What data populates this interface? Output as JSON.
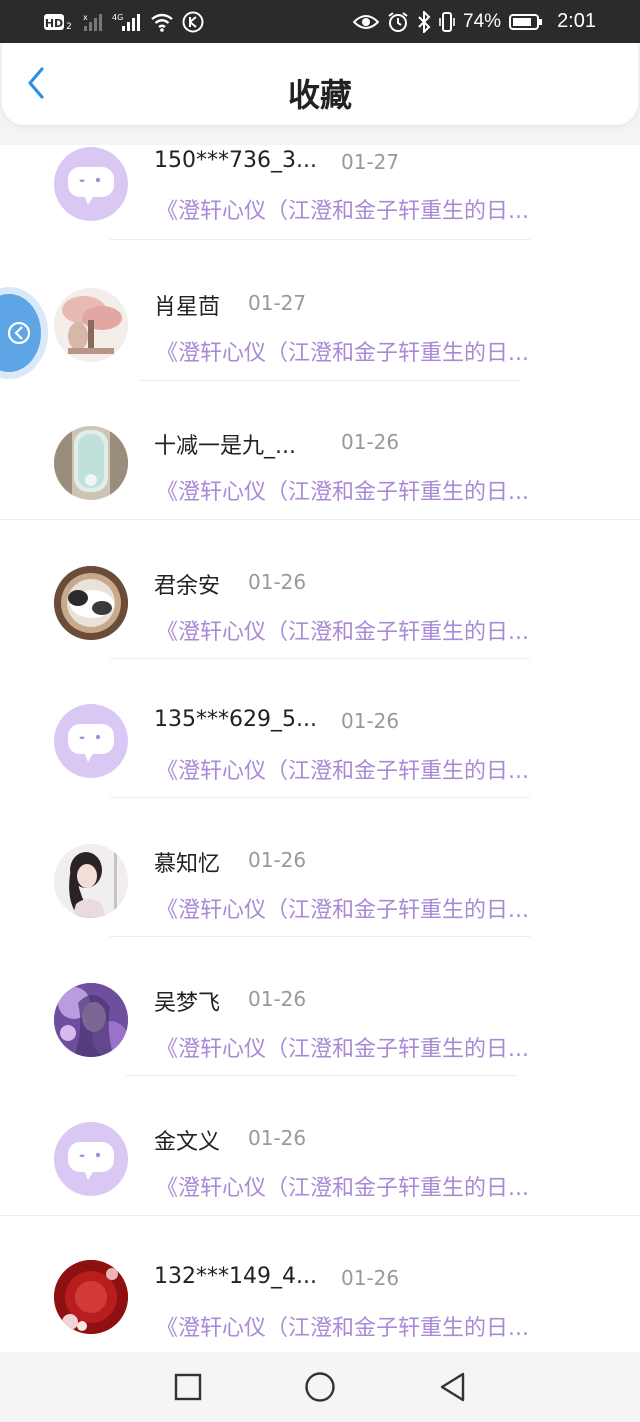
{
  "status_bar": {
    "hd_label": "HD",
    "network_label": "4G",
    "battery_percent": "74%",
    "time": "2:01"
  },
  "header": {
    "title": "收藏",
    "back_icon": "chevron-left-icon"
  },
  "items": [
    {
      "name": "150***736_3...",
      "date": "01-27",
      "title": "《澄轩心仪（江澄和金子轩重生的日...",
      "avatar": "default"
    },
    {
      "name": "肖星茴",
      "date": "01-27",
      "title": "《澄轩心仪（江澄和金子轩重生的日...",
      "avatar": "photo-pink"
    },
    {
      "name": "十减一是九_...",
      "date": "01-26",
      "title": "《澄轩心仪（江澄和金子轩重生的日...",
      "avatar": "photo-window"
    },
    {
      "name": "君余安",
      "date": "01-26",
      "title": "《澄轩心仪（江澄和金子轩重生的日...",
      "avatar": "photo-cat"
    },
    {
      "name": "135***629_5...",
      "date": "01-26",
      "title": "《澄轩心仪（江澄和金子轩重生的日...",
      "avatar": "default"
    },
    {
      "name": "慕知忆",
      "date": "01-26",
      "title": "《澄轩心仪（江澄和金子轩重生的日...",
      "avatar": "photo-girl"
    },
    {
      "name": "吴梦飞",
      "date": "01-26",
      "title": "《澄轩心仪（江澄和金子轩重生的日...",
      "avatar": "photo-purple"
    },
    {
      "name": "金文义",
      "date": "01-26",
      "title": "《澄轩心仪（江澄和金子轩重生的日...",
      "avatar": "default"
    },
    {
      "name": "132***149_4...",
      "date": "01-26",
      "title": "《澄轩心仪（江澄和金子轩重生的日...",
      "avatar": "photo-red"
    }
  ],
  "colors": {
    "accent_blue": "#2f8fe0",
    "title_purple": "#a98ad6",
    "default_avatar_bg": "#d9c8f3"
  },
  "nav": {
    "icons": [
      "square-icon",
      "circle-icon",
      "triangle-back-icon"
    ]
  }
}
